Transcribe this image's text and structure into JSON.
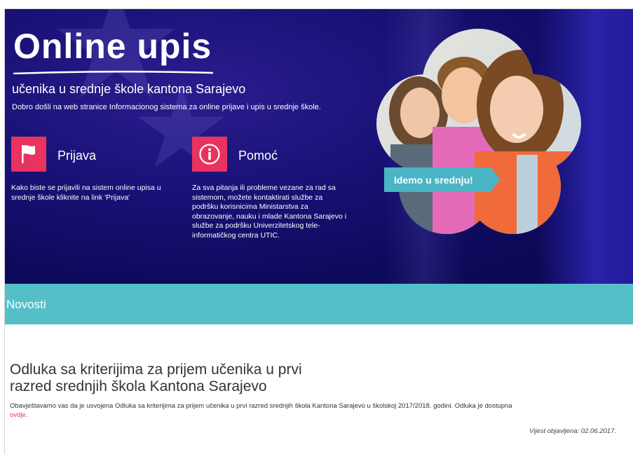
{
  "hero": {
    "title": "Online upis",
    "subtitle": "učenika u srednje škole kantona Sarajevo",
    "welcome": "Dobro došli na web stranice Informacionog sistema za online prijave i upis u srednje škole.",
    "banner": "Idemo u srednju!"
  },
  "cards": [
    {
      "title": "Prijava",
      "icon": "flag-icon",
      "text_lines": [
        "Kako biste se prijavili na sistem online upisa u",
        "srednje škole kliknite na link 'Prijava'"
      ]
    },
    {
      "title": "Pomoć",
      "icon": "info-icon",
      "text_lines": [
        "Za sva pitanja ili probleme vezane za rad sa",
        "sistemom, možete kontaktirati službe za",
        "podršku korisnicima Ministarstva za",
        "obrazovanje, nauku i mlade Kantona Sarajevo i",
        "službe za podršku Univerzitetskog tele-",
        "informatičkog centra UTIC."
      ]
    }
  ],
  "news": {
    "header": "Novosti",
    "article": {
      "title_lines": [
        "Odluka sa kriterijima za prijem učenika u prvi",
        "razred srednjih škola Kantona Sarajevo"
      ],
      "body": "Obavještavamo vas da je usvojena Odluka sa kriterijima za prijem učenika u prvi razred srednjih škola Kantona Sarajevo u školskoj 2017/2018. godini. Odluka je dostupna",
      "link": "ovdje.",
      "published": "Vijest objavljena: 02.06.2017."
    }
  },
  "colors": {
    "accent": "#e8325f",
    "teal": "#55bfc8",
    "hero_bg": "#1a1278"
  }
}
